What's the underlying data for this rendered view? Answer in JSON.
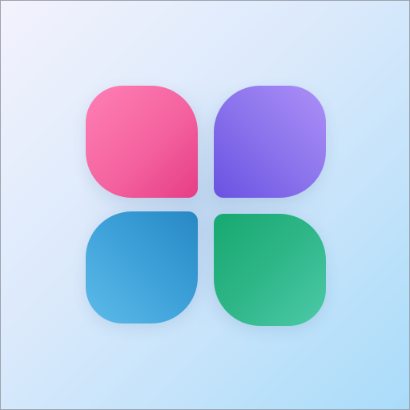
{
  "colors": {
    "background_top_left": "#f3f2fd",
    "background_bottom_right": "#a9dcfa",
    "border": "#9aa3ad",
    "petal_pink": "#f4639f",
    "petal_purple": "#8b74ec",
    "petal_blue": "#3fa2da",
    "petal_green": "#2fb688"
  },
  "icon": {
    "name": "four-petal-app-grid-icon",
    "petals": [
      "pink-petal",
      "purple-petal",
      "blue-petal",
      "green-petal"
    ]
  }
}
